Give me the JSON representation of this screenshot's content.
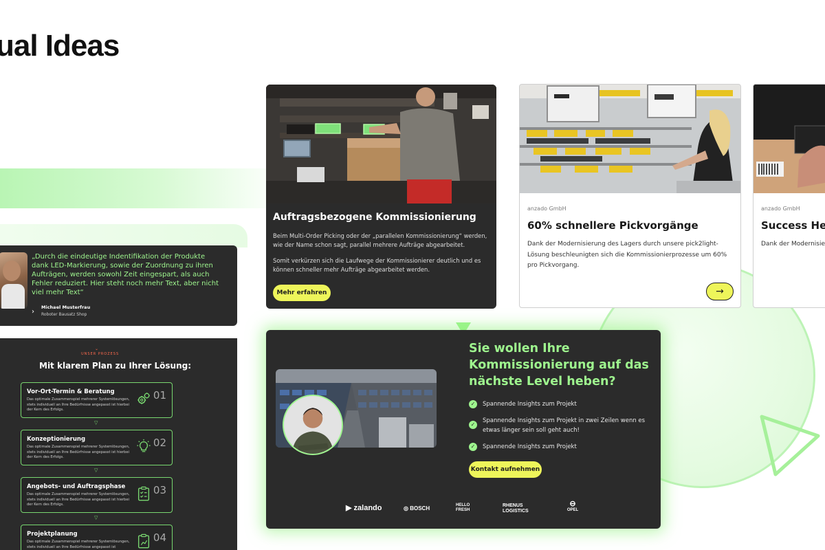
{
  "page": {
    "title": "ual Ideas"
  },
  "testimonial": {
    "quote": "„Durch die eindeutige Indentifikation der Produkte dank LED-Markierung, sowie der Zuordnung zu ihren Aufträgen, werden sowohl Zeit eingespart, als auch Fehler reduziert. Hier steht noch mehr Text, aber nicht viel mehr Text“",
    "name": "Michael Musterfrau",
    "company": "Roboter Bausatz Shop"
  },
  "process": {
    "kicker": "UNSER PROZESS",
    "title": "Mit klarem Plan zu Ihrer Lösung:",
    "steps": [
      {
        "title": "Vor-Ort-Termin & Beratung",
        "desc": "Das optimale Zusammenspiel mehrerer Systemlösungen, stets individuell an Ihre Bedürfnisse angepasst ist hierbei der Kern des Erfolgs.",
        "num": "01",
        "icon": "gears-icon"
      },
      {
        "title": "Konzeptionierung",
        "desc": "Das optimale Zusammenspiel mehrerer Systemlösungen, stets individuell an Ihre Bedürfnisse angepasst ist hierbei der Kern des Erfolgs.",
        "num": "02",
        "icon": "lightbulb-icon"
      },
      {
        "title": "Angebots- und Auftragsphase",
        "desc": "Das optimale Zusammenspiel mehrerer Systemlösungen, stets individuell an Ihre Bedürfnisse angepasst ist hierbei der Kern des Erfolgs.",
        "num": "03",
        "icon": "clipboard-check-icon"
      },
      {
        "title": "Projektplanung",
        "desc": "Das optimale Zusammenspiel mehrerer Systemlösungen, stets individuell an Ihre Bedürfnisse angepasst ist",
        "num": "04",
        "icon": "clipboard-plan-icon"
      }
    ]
  },
  "service": {
    "title": "Auftragsbezogene Kommissionierung",
    "p1": "Beim Multi-Order Picking oder der „parallelen Kommissionierung“ werden, wie der Name schon sagt, parallel mehrere Aufträge abgearbeitet.",
    "p2": "Somit verkürzen sich die Laufwege der Kommissionierer deutlich und es können schneller mehr Aufträge abgearbeitet werden.",
    "button": "Mehr erfahren"
  },
  "cases": [
    {
      "company": "anzado GmbH",
      "title": "60% schnellere Pickvorgänge",
      "text": "Dank der Modernisierung des Lagers durch unsere pick2light-Lösung beschleunigten sich die Kommissionierprozesse um 60% pro Pickvorgang.",
      "arrow": "→"
    },
    {
      "company": "anzado GmbH",
      "title": "Success He",
      "text": "Dank der Modernisier pick2light-Lösung b Kommissionierproze"
    }
  ],
  "cta": {
    "heading": "Sie wollen Ihre Kommissionierung auf das nächste Level heben?",
    "bullets": [
      "Spannende Insights zum Projekt",
      "Spannende Insights zum Projekt in zwei Zeilen wenn es etwas länger sein soll geht auch!",
      "Spannende Insights zum Projekt"
    ],
    "button": "Kontakt aufnehmen",
    "logos": [
      "zalando",
      "BOSCH",
      "HELLO FRESH",
      "RHENUS LOGISTICS",
      "OPEL"
    ]
  },
  "colors": {
    "green": "#9ef58e",
    "yellow": "#eef55a",
    "dark": "#2b2b2b"
  }
}
